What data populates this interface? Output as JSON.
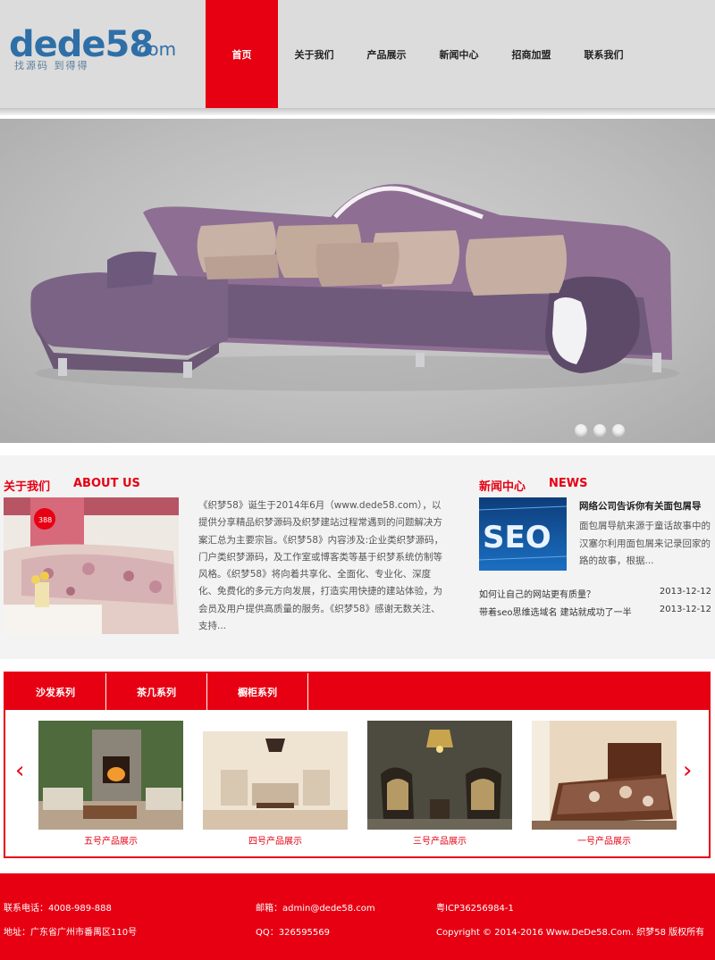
{
  "logo": {
    "main": "dede58",
    "tld": ".com",
    "slogan": "找源码 到得得"
  },
  "nav": [
    {
      "label": "首页",
      "active": true
    },
    {
      "label": "关于我们",
      "active": false
    },
    {
      "label": "产品展示",
      "active": false
    },
    {
      "label": "新闻中心",
      "active": false
    },
    {
      "label": "招商加盟",
      "active": false
    },
    {
      "label": "联系我们",
      "active": false
    }
  ],
  "banner": {
    "slide_count": 3,
    "active_slide": 1
  },
  "about": {
    "title_cn": "关于我们",
    "title_en": "ABOUT US",
    "badge": "388",
    "text": "《织梦58》诞生于2014年6月（www.dede58.com），以提供分享精品织梦源码及织梦建站过程常遇到的问题解决方案汇总为主要宗旨。《织梦58》内容涉及:企业类织梦源码，门户类织梦源码，及工作室或博客类等基于织梦系统仿制等风格。《织梦58》将向着共享化、全面化、专业化、深度化、免费化的多元方向发展，打造实用快捷的建站体验，为会员及用户提供高质量的服务。《织梦58》感谢无数关注、支持..."
  },
  "news": {
    "title_cn": "新闻中心",
    "title_en": "NEWS",
    "featured": {
      "image_text": "SEO",
      "title": "网络公司告诉你有关面包屑导",
      "summary": "面包屑导航来源于童话故事中的汉塞尔利用面包屑来记录回家的路的故事，根据..."
    },
    "items": [
      {
        "title": "如何让自己的网站更有质量？",
        "date": "2013-12-12"
      },
      {
        "title": "带着seo思维选域名 建站就成功了一半",
        "date": "2013-12-12"
      }
    ]
  },
  "products": {
    "tabs": [
      "沙发系列",
      "茶几系列",
      "橱柜系列"
    ],
    "prev_arrow": "‹",
    "next_arrow": "›",
    "items": [
      {
        "caption": "五号产品展示"
      },
      {
        "caption": "四号产品展示"
      },
      {
        "caption": "三号产品展示"
      },
      {
        "caption": "一号产品展示"
      }
    ]
  },
  "footer": {
    "phone": "联系电话：4008-989-888",
    "address": "地址：广东省广州市番禺区110号",
    "email": "邮箱：admin@dede58.com",
    "qq": "QQ：326595569",
    "icp": "粤ICP36256984-1",
    "copyright": "Copyright © 2014-2016 Www.DeDe58.Com. 织梦58 版权所有"
  },
  "colors": {
    "brand_red": "#e60012",
    "logo_blue": "#2f6fa8",
    "header_gray": "#dcdcdc"
  }
}
